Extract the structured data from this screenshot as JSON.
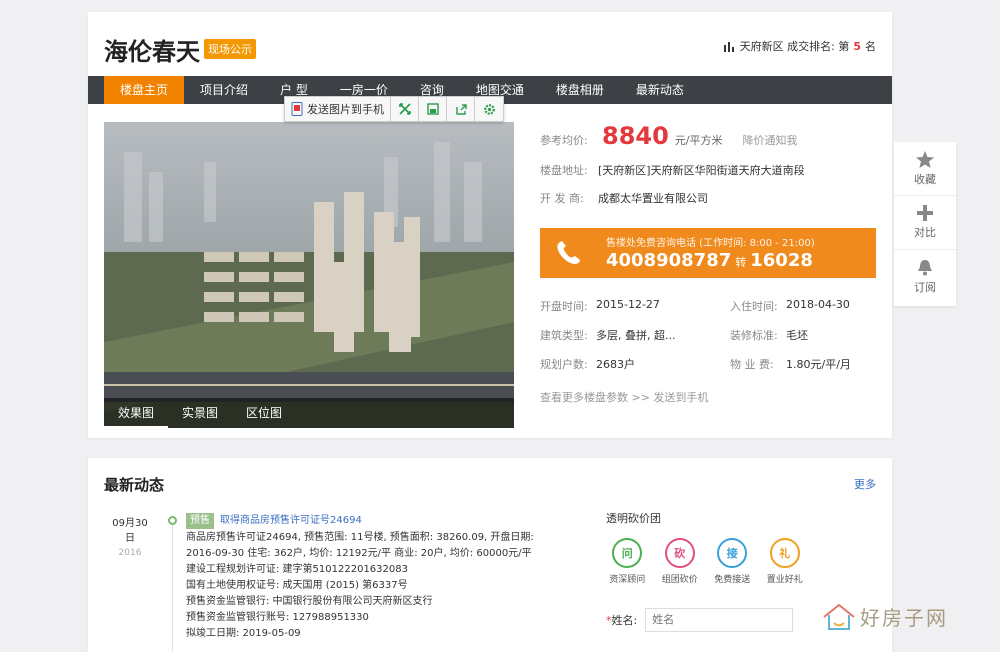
{
  "header": {
    "title": "海伦春天",
    "badge": "现场公示",
    "rank_prefix": "天府新区 成交排名: 第",
    "rank_num": "5",
    "rank_suffix": "名"
  },
  "nav": {
    "items": [
      "楼盘主页",
      "项目介绍",
      "户 型",
      "一房一价",
      "咨询",
      "地图交通",
      "楼盘相册",
      "最新动态"
    ]
  },
  "popup": {
    "send_label": "发送图片到手机"
  },
  "hero": {
    "tabs": [
      "效果图",
      "实景图",
      "区位图"
    ]
  },
  "info": {
    "price_label": "参考均价:",
    "price": "8840",
    "price_unit": "元/平方米",
    "notify": "降价通知我",
    "address_label": "楼盘地址:",
    "address": "[天府新区]天府新区华阳街道天府大道南段",
    "developer_label": "开 发 商:",
    "developer": "成都太华置业有限公司"
  },
  "phone": {
    "caption": "售楼处免费咨询电话 (工作时间: 8:00 - 21:00)",
    "number": "4008908787",
    "zhuan": "转",
    "ext": "16028"
  },
  "details": {
    "open_label": "开盘时间:",
    "open": "2015-12-27",
    "move_label": "入住时间:",
    "move": "2018-04-30",
    "type_label": "建筑类型:",
    "type": "多层, 叠拼, 超...",
    "deco_label": "装修标准:",
    "deco": "毛坯",
    "units_label": "规划户数:",
    "units": "2683户",
    "fee_label": "物 业 费:",
    "fee": "1.80元/平/月",
    "more": "查看更多楼盘参数 >> 发送到手机"
  },
  "side": {
    "items": [
      "收藏",
      "对比",
      "订阅"
    ]
  },
  "news_section": {
    "title": "最新动态",
    "more": "更多",
    "date_md": "09月30",
    "date_d": "日",
    "date_y": "2016",
    "tag": "预售",
    "headline": "取得商品房预售许可证号24694",
    "lines": [
      "商品房预售许可证24694, 预售范围: 11号楼, 预售面积: 38260.09, 开盘日期:",
      "2016-09-30 住宅: 362户, 均价: 12192元/平 商业: 20户, 均价: 60000元/平",
      "建设工程规划许可证: 建字第510122201632083",
      "国有土地使用权证号: 成天国用 (2015) 第6337号",
      "预售资金监管银行: 中国银行股份有限公司天府新区支行",
      "预售资金监管银行账号: 127988951330",
      "拟竣工日期: 2019-05-09"
    ]
  },
  "bargain": {
    "title": "透明砍价团",
    "items": [
      {
        "glyph": "问",
        "label": "资深顾问",
        "color": "#4caf50"
      },
      {
        "glyph": "砍",
        "label": "组团砍价",
        "color": "#e0507a"
      },
      {
        "glyph": "接",
        "label": "免费接送",
        "color": "#3aa0d8"
      },
      {
        "glyph": "礼",
        "label": "置业好礼",
        "color": "#f0a020"
      }
    ],
    "name_label": "姓名:",
    "name_placeholder": "姓名"
  },
  "watermark": {
    "text": "好房子网"
  }
}
